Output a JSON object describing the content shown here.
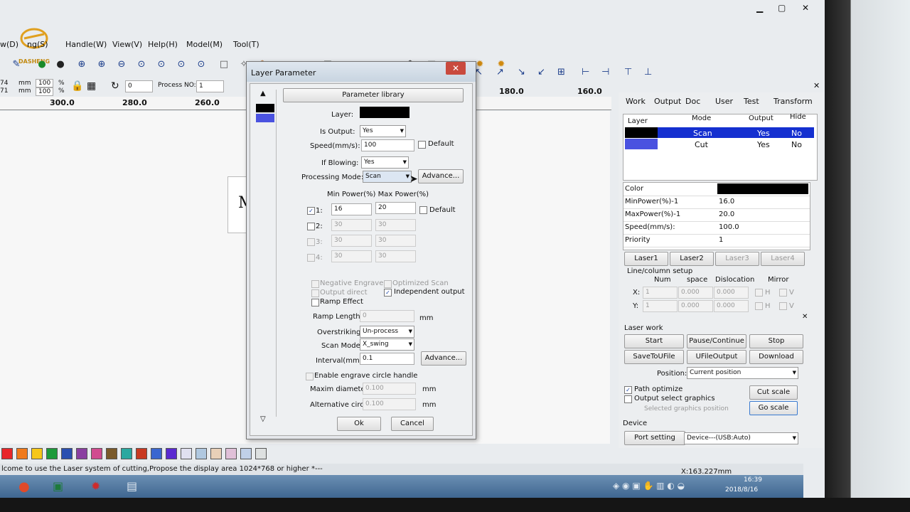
{
  "menu": [
    "w(D)",
    "ng(S)",
    "Handle(W)",
    "View(V)",
    "Help(H)",
    "Model(M)",
    "Tool(T)"
  ],
  "logo_text": "DASHENG",
  "toolbar_fields": {
    "val_74": "74",
    "val_71": "71",
    "unit_mm1": "mm",
    "unit_mm2": "mm",
    "pct1": "100",
    "pct2": "100",
    "pct_sign1": "%",
    "pct_sign2": "%",
    "rotate_val": "0",
    "process_no_label": "Process NO:",
    "process_no_val": "1"
  },
  "ruler": [
    "300.0",
    "280.0",
    "260.0",
    "180.0",
    "160.0"
  ],
  "dialog": {
    "title": "Layer Parameter",
    "param_library": "Parameter library",
    "layer_label": "Layer:",
    "layer_color": "#000000",
    "is_output_label": "Is Output:",
    "is_output_val": "Yes",
    "speed_label": "Speed(mm/s):",
    "speed_val": "100",
    "default_label": "Default",
    "if_blowing_label": "If Blowing:",
    "if_blowing_val": "Yes",
    "processing_mode_label": "Processing Mode:",
    "processing_mode_val": "Scan",
    "advance_label": "Advance...",
    "power_header": "Min Power(%) Max Power(%)",
    "power_rows": [
      {
        "n": "1:",
        "min": "16",
        "max": "20"
      },
      {
        "n": "2:",
        "min": "30",
        "max": "30"
      },
      {
        "n": "3:",
        "min": "30",
        "max": "30"
      },
      {
        "n": "4:",
        "min": "30",
        "max": "30"
      }
    ],
    "power_default": "Default",
    "negative_engrave": "Negative Engrave",
    "optimized_scan": "Optimized Scan",
    "output_direct": "Output direct",
    "independent_output": "Independent output",
    "ramp_effect": "Ramp Effect",
    "ramp_length_label": "Ramp Length:",
    "ramp_length_val": "0",
    "mm": "mm",
    "overstriking_label": "Overstriking:",
    "overstriking_val": "Un-process",
    "scan_mode_label": "Scan Mode:",
    "scan_mode_val": "X_swing",
    "interval_label": "Interval(mm):",
    "interval_val": "0.1",
    "advance2_label": "Advance...",
    "enable_circle": "Enable engrave circle handle",
    "maxim_diameter_label": "Maxim diameter:",
    "maxim_diameter_val": "0.100",
    "alt_circle_label": "Alternative circle",
    "alt_circle_val": "0.100",
    "ok": "Ok",
    "cancel": "Cancel"
  },
  "right_panel": {
    "tabs": [
      "Work",
      "Output",
      "Doc",
      "User",
      "Test",
      "Transform"
    ],
    "table_headers": [
      "Layer",
      "Mode",
      "Output",
      "Hide"
    ],
    "layers": [
      {
        "color": "#000000",
        "mode": "Scan",
        "output": "Yes",
        "hide": "No"
      },
      {
        "color": "#4a52e0",
        "mode": "Cut",
        "output": "Yes",
        "hide": "No"
      }
    ],
    "props": [
      {
        "k": "Color",
        "v": ""
      },
      {
        "k": "MinPower(%)-1",
        "v": "16.0"
      },
      {
        "k": "MaxPower(%)-1",
        "v": "20.0"
      },
      {
        "k": "Speed(mm/s):",
        "v": "100.0"
      },
      {
        "k": "Priority",
        "v": "1"
      }
    ],
    "laser_tabs": [
      "Laser1",
      "Laser2",
      "Laser3",
      "Laser4"
    ],
    "line_col_setup": "Line/column setup",
    "grid_headers": [
      "Num",
      "space",
      "Dislocation",
      "Mirror"
    ],
    "x_label": "X:",
    "y_label": "Y:",
    "x_vals": [
      "1",
      "0.000",
      "0.000"
    ],
    "y_vals": [
      "1",
      "0.000",
      "0.000"
    ],
    "mirror_h": "H",
    "mirror_v": "V",
    "laser_work": "Laser work",
    "start": "Start",
    "pause": "Pause/Continue",
    "stop": "Stop",
    "save_to_file": "SaveToUFile",
    "ufile_output": "UFileOutput",
    "download": "Download",
    "position_label": "Position:",
    "position_val": "Current position",
    "path_optimize": "Path optimize",
    "output_select": "Output select graphics",
    "selected_pos": "Selected graphics position",
    "cut_scale": "Cut scale",
    "go_scale": "Go scale",
    "device_label": "Device",
    "port_setting": "Port setting",
    "device_val": "Device---(USB:Auto)"
  },
  "status": {
    "msg": "lcome to use the Laser system of cutting,Propose the display area 1024*768 or higher *---",
    "coord": "X:163.227mm",
    "time": "16:39",
    "date": "2018/8/16"
  },
  "palette": [
    "#e8262a",
    "#f07a1c",
    "#f6c71a",
    "#1d9a3b",
    "#2a4fb0",
    "#8a3fa0",
    "#d14a8f",
    "#7a5a2a",
    "#2aa8a0",
    "#c83a22",
    "#3a66d0",
    "#5a2ad0",
    "#e0e0f0",
    "#b0c8e0",
    "#e8d0b8",
    "#e0c0d8",
    "#c0d0e8",
    "#dde0e0"
  ]
}
